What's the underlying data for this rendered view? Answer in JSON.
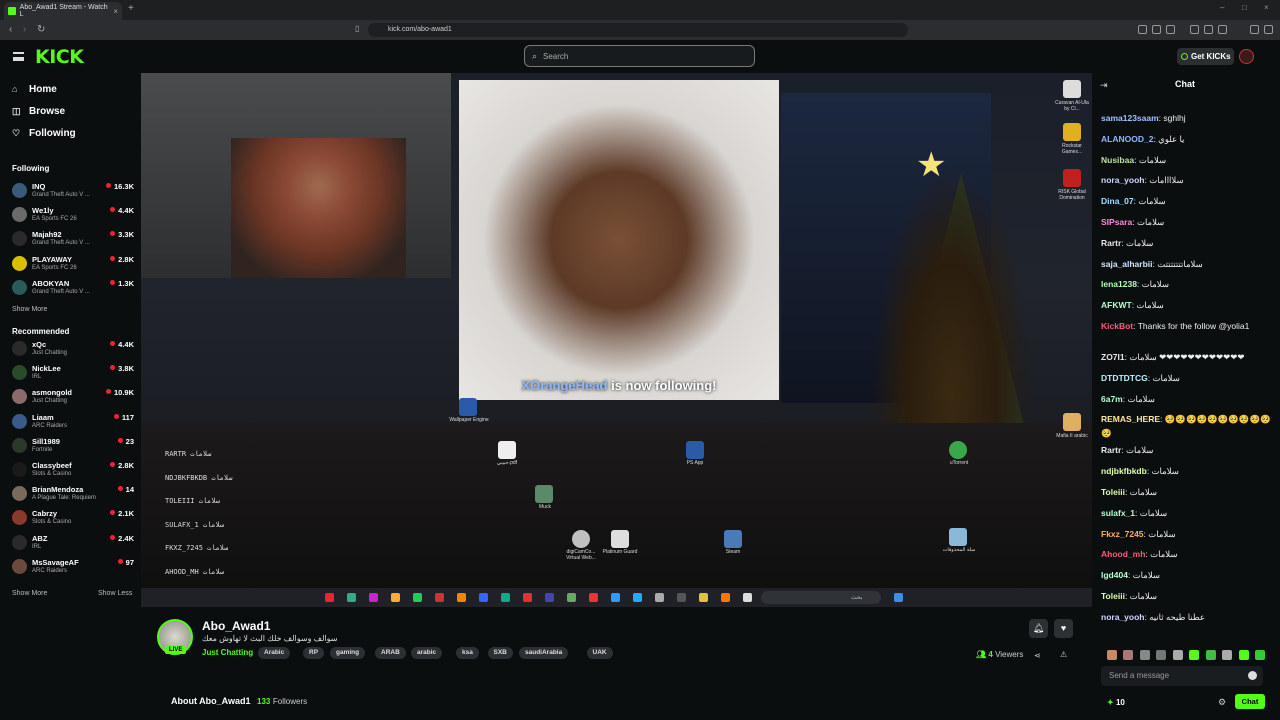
{
  "browser": {
    "tab_title": "Abo_Awad1 Stream - Watch L",
    "url": "kick.com/abo-awad1"
  },
  "header": {
    "logo": "KICK",
    "search_placeholder": "Search",
    "get_kicks": "Get KICKs"
  },
  "sidebar": {
    "nav": [
      {
        "label": "Home",
        "icon": "home-icon"
      },
      {
        "label": "Browse",
        "icon": "browse-icon"
      },
      {
        "label": "Following",
        "icon": "heart-icon"
      }
    ],
    "following_heading": "Following",
    "following": [
      {
        "name": "INQ",
        "game": "Grand Theft Auto V ...",
        "viewers": "16.3K",
        "color": "#3a5a7a"
      },
      {
        "name": "We1ly",
        "game": "EA Sports FC 26",
        "viewers": "4.4K",
        "color": "#6a6a6a"
      },
      {
        "name": "Majah92",
        "game": "Grand Theft Auto V ...",
        "viewers": "3.3K",
        "color": "#2a2a2a"
      },
      {
        "name": "PLAYAWAY",
        "game": "EA Sports FC 26",
        "viewers": "2.8K",
        "color": "#d8c000"
      },
      {
        "name": "ABOKYAN",
        "game": "Grand Theft Auto V ...",
        "viewers": "1.3K",
        "color": "#2a5a5a"
      }
    ],
    "show_more_1": "Show More",
    "recommended_heading": "Recommended",
    "recommended": [
      {
        "name": "xQc",
        "game": "Just Chatting",
        "viewers": "4.4K",
        "color": "#2a2a2a"
      },
      {
        "name": "NickLee",
        "game": "IRL",
        "viewers": "3.8K",
        "color": "#2a4a2a"
      },
      {
        "name": "asmongold",
        "game": "Just Chatting",
        "viewers": "10.9K",
        "color": "#8a6a6a"
      },
      {
        "name": "Liaam",
        "game": "ARC Raiders",
        "viewers": "117",
        "color": "#3a5a8a"
      },
      {
        "name": "Sill1989",
        "game": "Fortnite",
        "viewers": "23",
        "color": "#2a3a2a"
      },
      {
        "name": "Classybeef",
        "game": "Slots & Casino",
        "viewers": "2.8K",
        "color": "#1a1a1a"
      },
      {
        "name": "BrianMendoza",
        "game": "A Plague Tale: Requiem",
        "viewers": "14",
        "color": "#7a6a5a"
      },
      {
        "name": "Cabrzy",
        "game": "Slots & Casino",
        "viewers": "2.1K",
        "color": "#8a3a2a"
      },
      {
        "name": "ABZ",
        "game": "IRL",
        "viewers": "2.4K",
        "color": "#2a2a2a"
      },
      {
        "name": "MsSavageAF",
        "game": "ARC Raiders",
        "viewers": "97",
        "color": "#6a4a3a"
      }
    ],
    "show_more_2": "Show More",
    "show_less": "Show Less"
  },
  "video": {
    "alert_user": "XOrangeHead",
    "alert_text": "is now following!",
    "overlay_chat": [
      "RARTR سلامات",
      "NDJBKFBKDB سلامات",
      "TOLEIII سلامات",
      "SULAFX_1 سلامات",
      "FKXZ_7245 سلامات",
      "AHOOD_MH سلامات"
    ],
    "desktop_icons": [
      "Wallpaper Engine",
      "حبيبي.pdf",
      "PS App",
      "Muck",
      "digiCamCo... Virtual Web...",
      "Platinum Guard",
      "Steam",
      "Caravan Al-Ula by Cl...",
      "Rockstar Games...",
      "RISK Global Domination",
      "Mafia II arabic",
      "uTorrent",
      "سلة المحذوفات"
    ],
    "taskbar_search": "بحث"
  },
  "channel": {
    "name": "Abo_Awad1",
    "live": "LIVE",
    "title": "سوالف وسوالف خلك البث لا تهاوش معك",
    "category": "Just Chatting",
    "tags": [
      "Arabic",
      "RP",
      "gaming",
      "ARAB",
      "arabic",
      "ksa",
      "SXB",
      "saudiArabia",
      "UAK"
    ],
    "viewers": "4",
    "viewers_label": "Viewers",
    "about": "About Abo_Awad1",
    "followers": "133",
    "followers_label": "Followers"
  },
  "chat": {
    "title": "Chat",
    "messages": [
      {
        "user": "sama123saam",
        "text": "sghlhj",
        "color": "#9cc4ff"
      },
      {
        "user": "ALANOOD_2",
        "text": "يا علوي",
        "color": "#8fb7ff"
      },
      {
        "user": "Nusibaa",
        "text": "سلامات",
        "color": "#b7e3a0"
      },
      {
        "user": "nora_yooh",
        "text": "سلاااامات",
        "color": "#cfd8ff"
      },
      {
        "user": "Dina_07",
        "text": "سلامات",
        "color": "#9fe0ff"
      },
      {
        "user": "SIPsara",
        "text": "سلامات",
        "color": "#ff8ad8"
      },
      {
        "user": "Rartr",
        "text": "سلامات",
        "color": "#e8e8e8"
      },
      {
        "user": "saja_alharbii",
        "text": "سلاماتتتتتتتت",
        "color": "#cfe8ff"
      },
      {
        "user": "lena1238",
        "text": "سلامات",
        "color": "#b5ffb5"
      },
      {
        "user": "AFKWT",
        "text": "سلامات",
        "color": "#b5ffd0"
      },
      {
        "user": "KickBot",
        "text": "Thanks for the follow @yolia1",
        "color": "#ff5a7a"
      },
      {
        "user": "ZO7I1",
        "text": "سلامات ❤❤❤❤❤❤❤❤❤❤❤❤",
        "color": "#e8e8e8"
      },
      {
        "user": "DTDTDTCG",
        "text": "سلامات",
        "color": "#b5f2ff"
      },
      {
        "user": "6a7m",
        "text": "سلامات",
        "color": "#b5ffd0"
      },
      {
        "user": "REMAS_HERE",
        "text": "🥺🥺🥺🥺🥺🥺🥺🥺🥺🥺🥺",
        "color": "#ffe7a0"
      },
      {
        "user": "Rartr",
        "text": "سلامات",
        "color": "#e8e8e8"
      },
      {
        "user": "ndjbkfbkdb",
        "text": "سلامات",
        "color": "#dfffb5"
      },
      {
        "user": "Toleiii",
        "text": "سلامات",
        "color": "#dfffb5"
      },
      {
        "user": "sulafx_1",
        "text": "سلامات",
        "color": "#b5ffd0"
      },
      {
        "user": "Fkxz_7245",
        "text": "سلامات",
        "color": "#ffb060"
      },
      {
        "user": "Ahood_mh",
        "text": "سلامات",
        "color": "#ff5a7a"
      },
      {
        "user": "lgd404",
        "text": "سلامات",
        "color": "#b5ffd0"
      },
      {
        "user": "Toleiii",
        "text": "سلامات",
        "color": "#dfffb5"
      },
      {
        "user": "nora_yooh",
        "text": "عطنا طيحه ثانيه",
        "color": "#cfd8ff"
      }
    ],
    "input_placeholder": "Send a message",
    "kicks": "10",
    "send_label": "Chat"
  }
}
